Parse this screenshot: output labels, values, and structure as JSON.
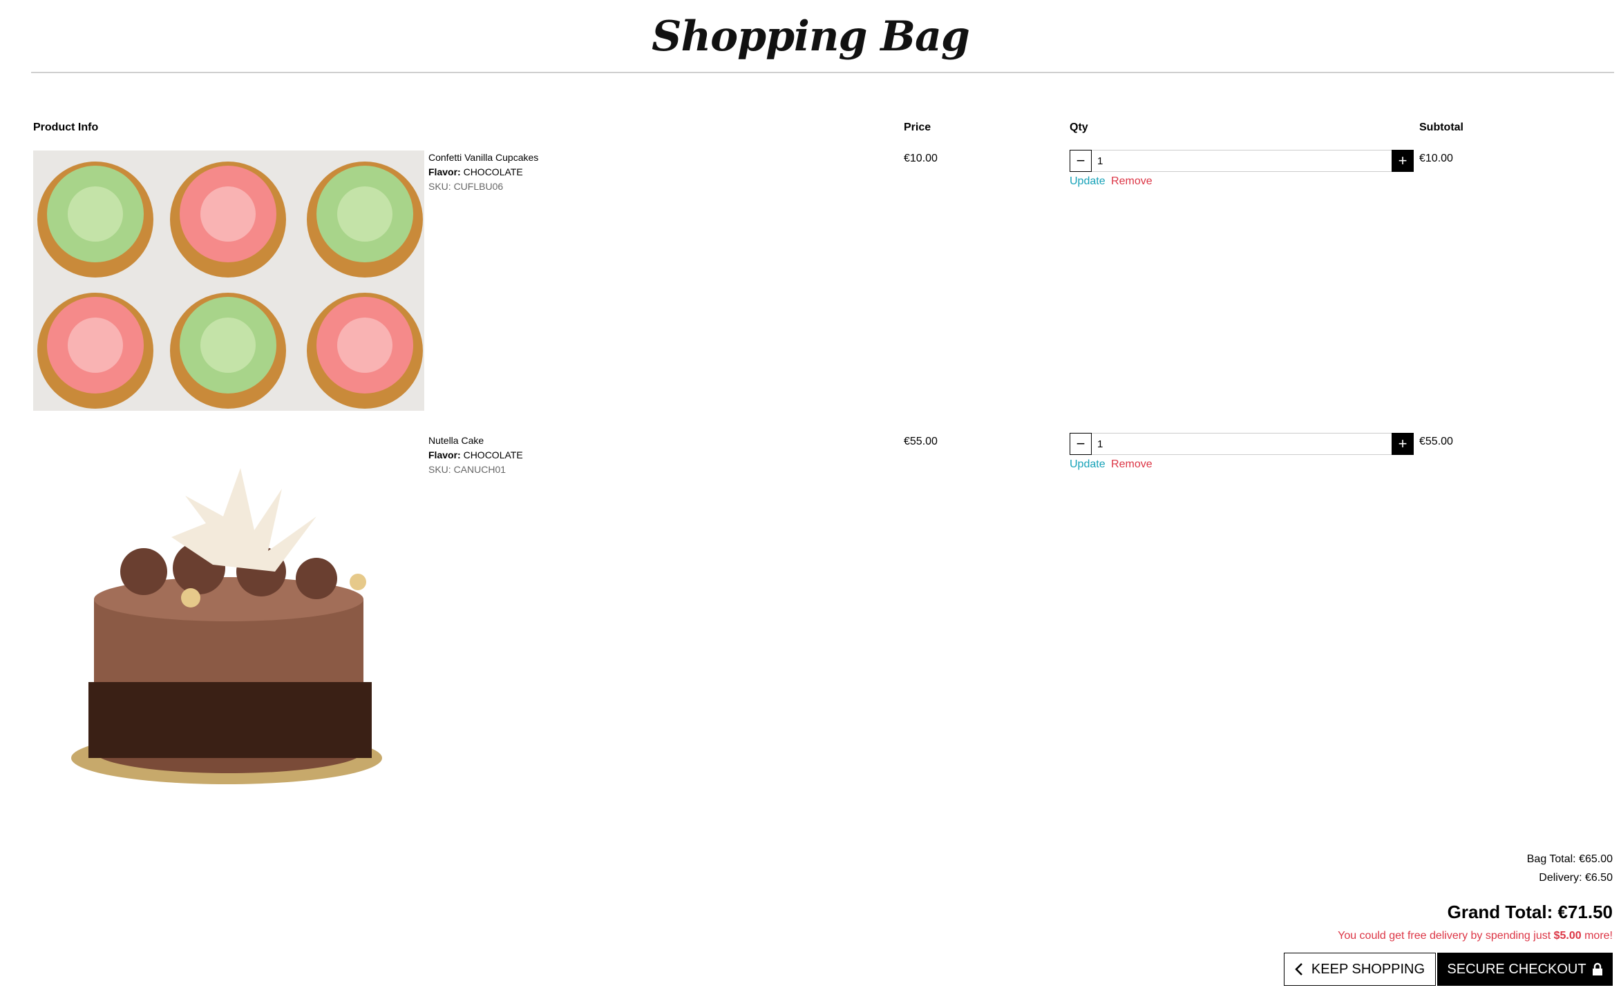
{
  "page": {
    "title": "Shopping Bag"
  },
  "table": {
    "headers": {
      "product_info": "Product Info",
      "price": "Price",
      "qty": "Qty",
      "subtotal": "Subtotal"
    }
  },
  "items": [
    {
      "name": "Confetti Vanilla Cupcakes",
      "flavor_label": "Flavor:",
      "flavor_value": "CHOCOLATE",
      "sku": "SKU: CUFLBU06",
      "price": "€10.00",
      "qty": "1",
      "subtotal": "€10.00",
      "update_label": "Update",
      "remove_label": "Remove"
    },
    {
      "name": "Nutella Cake",
      "flavor_label": "Flavor:",
      "flavor_value": "CHOCOLATE",
      "sku": "SKU: CANUCH01",
      "price": "€55.00",
      "qty": "1",
      "subtotal": "€55.00",
      "update_label": "Update",
      "remove_label": "Remove"
    }
  ],
  "summary": {
    "bag_total": "Bag Total: €65.00",
    "delivery": "Delivery: €6.50",
    "grand_total": "Grand Total: €71.50",
    "free_delivery_prefix": "You could get free delivery by spending just ",
    "free_delivery_amount": "$5.00",
    "free_delivery_suffix": " more!"
  },
  "actions": {
    "keep_shopping": "KEEP SHOPPING",
    "secure_checkout": "SECURE CHECKOUT"
  },
  "colors": {
    "link": "#17a2b8",
    "danger": "#dc3545",
    "primary": "#000000"
  }
}
